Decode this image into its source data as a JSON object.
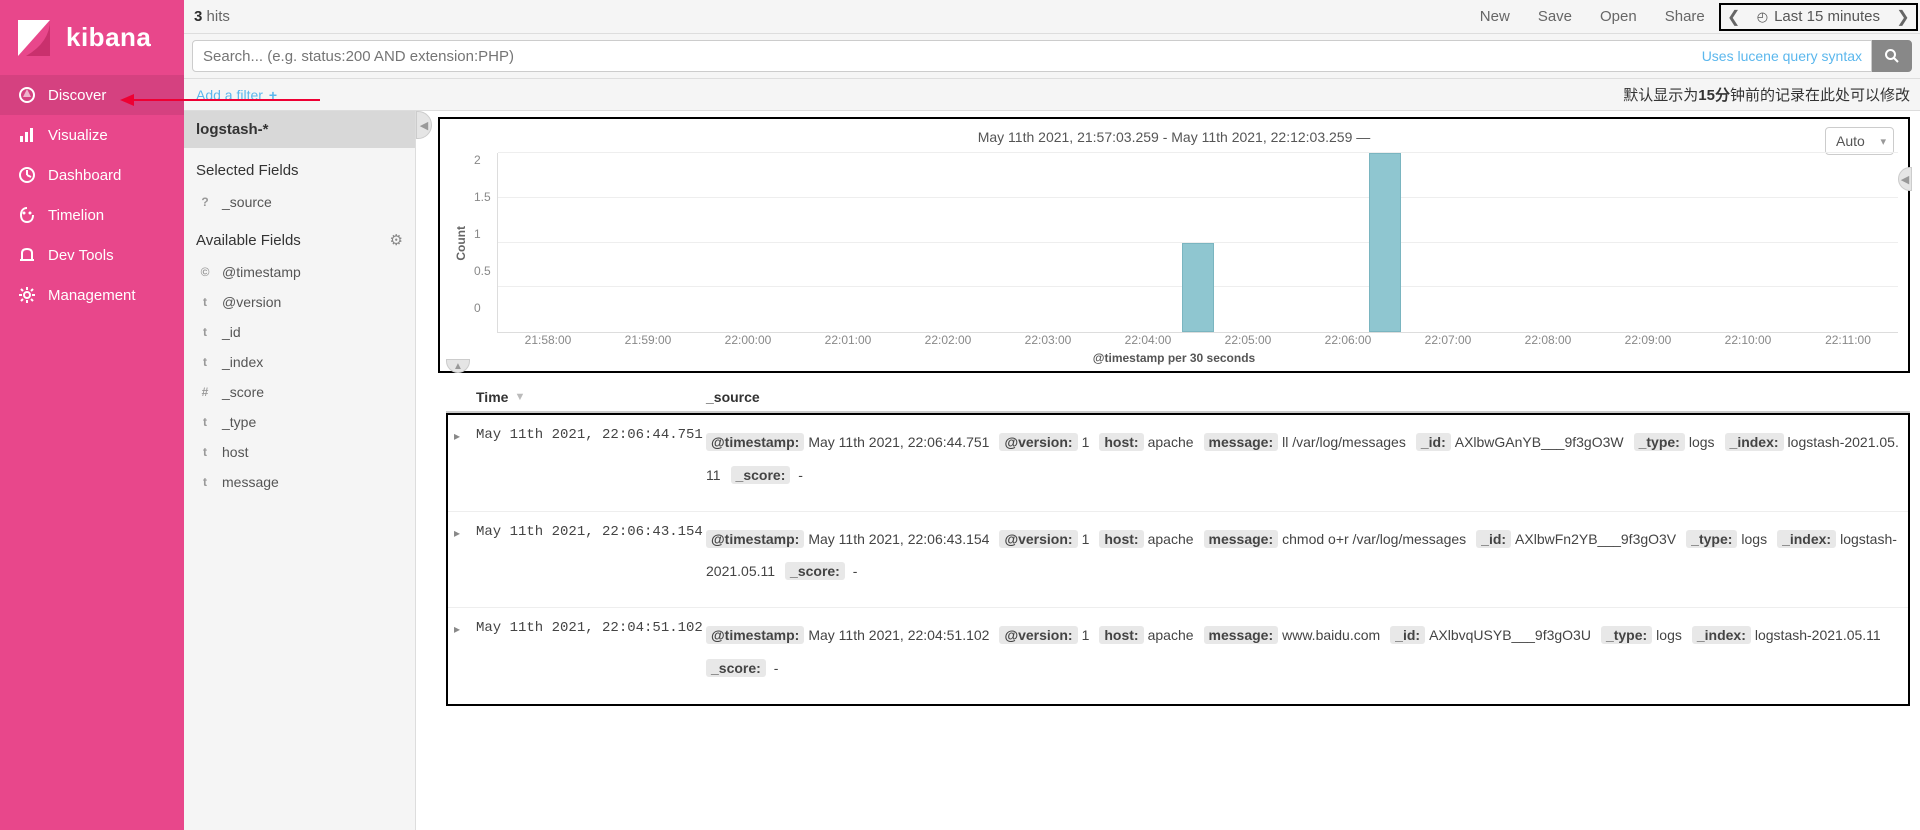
{
  "brand": {
    "name": "kibana"
  },
  "nav": {
    "items": [
      {
        "label": "Discover",
        "active": true
      },
      {
        "label": "Visualize",
        "active": false
      },
      {
        "label": "Dashboard",
        "active": false
      },
      {
        "label": "Timelion",
        "active": false
      },
      {
        "label": "Dev Tools",
        "active": false
      },
      {
        "label": "Management",
        "active": false
      }
    ]
  },
  "topbar": {
    "hits_count": "3",
    "hits_label": "hits",
    "links": [
      "New",
      "Save",
      "Open",
      "Share"
    ],
    "time_label": "Last 15 minutes"
  },
  "search": {
    "placeholder": "Search... (e.g. status:200 AND extension:PHP)",
    "lucene_hint": "Uses lucene query syntax"
  },
  "filter_row": {
    "add_filter": "Add a filter",
    "note_prefix": "默认显示为",
    "note_bold": "15分",
    "note_suffix": "钟前的记录在此处可以修改"
  },
  "fields_panel": {
    "index_pattern": "logstash-*",
    "selected_title": "Selected Fields",
    "selected": [
      {
        "type": "?",
        "name": "_source"
      }
    ],
    "available_title": "Available Fields",
    "available": [
      {
        "type": "©",
        "name": "@timestamp"
      },
      {
        "type": "t",
        "name": "@version"
      },
      {
        "type": "t",
        "name": "_id"
      },
      {
        "type": "t",
        "name": "_index"
      },
      {
        "type": "#",
        "name": "_score"
      },
      {
        "type": "t",
        "name": "_type"
      },
      {
        "type": "t",
        "name": "host"
      },
      {
        "type": "t",
        "name": "message"
      }
    ]
  },
  "chart": {
    "title": "May 11th 2021, 21:57:03.259 - May 11th 2021, 22:12:03.259 —",
    "interval_selected": "Auto",
    "ylabel": "Count",
    "xlabel": "@timestamp per 30 seconds"
  },
  "chart_data": {
    "type": "bar",
    "title": "May 11th 2021, 21:57:03.259 - May 11th 2021, 22:12:03.259",
    "xlabel": "@timestamp per 30 seconds",
    "ylabel": "Count",
    "ylim": [
      0,
      2
    ],
    "yticks": [
      0,
      0.5,
      1,
      1.5,
      2
    ],
    "xticks": [
      "21:58:00",
      "21:59:00",
      "22:00:00",
      "22:01:00",
      "22:02:00",
      "22:03:00",
      "22:04:00",
      "22:05:00",
      "22:06:00",
      "22:07:00",
      "22:08:00",
      "22:09:00",
      "22:10:00",
      "22:11:00"
    ],
    "bars": [
      {
        "x": "22:04:30",
        "value": 1
      },
      {
        "x": "22:06:30",
        "value": 2
      }
    ]
  },
  "table": {
    "columns": {
      "time": "Time",
      "source": "_source"
    },
    "rows": [
      {
        "time": "May 11th 2021, 22:06:44.751",
        "fields": [
          {
            "k": "@timestamp:",
            "v": "May 11th 2021, 22:06:44.751"
          },
          {
            "k": "@version:",
            "v": "1"
          },
          {
            "k": "host:",
            "v": "apache"
          },
          {
            "k": "message:",
            "v": "ll /var/log/messages"
          },
          {
            "k": "_id:",
            "v": "AXlbwGAnYB___9f3gO3W"
          },
          {
            "k": "_type:",
            "v": "logs"
          },
          {
            "k": "_index:",
            "v": "logstash-2021.05.11"
          },
          {
            "k": "_score:",
            "v": " - "
          }
        ]
      },
      {
        "time": "May 11th 2021, 22:06:43.154",
        "fields": [
          {
            "k": "@timestamp:",
            "v": "May 11th 2021, 22:06:43.154"
          },
          {
            "k": "@version:",
            "v": "1"
          },
          {
            "k": "host:",
            "v": "apache"
          },
          {
            "k": "message:",
            "v": "chmod o+r /var/log/messages"
          },
          {
            "k": "_id:",
            "v": "AXlbwFn2YB___9f3gO3V"
          },
          {
            "k": "_type:",
            "v": "logs"
          },
          {
            "k": "_index:",
            "v": "logstash-2021.05.11"
          },
          {
            "k": "_score:",
            "v": " - "
          }
        ]
      },
      {
        "time": "May 11th 2021, 22:04:51.102",
        "fields": [
          {
            "k": "@timestamp:",
            "v": "May 11th 2021, 22:04:51.102"
          },
          {
            "k": "@version:",
            "v": "1"
          },
          {
            "k": "host:",
            "v": "apache"
          },
          {
            "k": "message:",
            "v": "www.baidu.com"
          },
          {
            "k": "_id:",
            "v": "AXlbvqUSYB___9f3gO3U"
          },
          {
            "k": "_type:",
            "v": "logs"
          },
          {
            "k": "_index:",
            "v": "logstash-2021.05.11"
          },
          {
            "k": "_score:",
            "v": " - "
          }
        ]
      }
    ]
  }
}
